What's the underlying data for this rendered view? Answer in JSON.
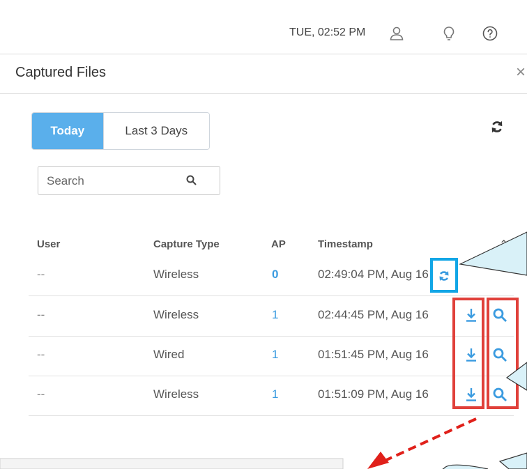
{
  "header": {
    "datetime": "TUE, 02:52 PM",
    "icons": [
      "user-icon",
      "lightbulb-icon",
      "help-icon"
    ]
  },
  "dialog": {
    "title": "Captured Files",
    "close_label": "×",
    "tabs": [
      {
        "label": "Today",
        "active": true
      },
      {
        "label": "Last 3 Days",
        "active": false
      }
    ],
    "search_placeholder": "Search",
    "columns": {
      "user": "User",
      "capture_type": "Capture Type",
      "ap": "AP",
      "timestamp": "Timestamp"
    },
    "rows": [
      {
        "user": "--",
        "capture_type": "Wireless",
        "ap": "0",
        "timestamp": "02:49:04 PM, Aug 16",
        "action": "in-progress"
      },
      {
        "user": "--",
        "capture_type": "Wireless",
        "ap": "1",
        "timestamp": "02:44:45 PM, Aug 16",
        "action": "download-view"
      },
      {
        "user": "--",
        "capture_type": "Wired",
        "ap": "1",
        "timestamp": "01:51:45 PM, Aug 16",
        "action": "download-view"
      },
      {
        "user": "--",
        "capture_type": "Wireless",
        "ap": "1",
        "timestamp": "01:51:09 PM, Aug 16",
        "action": "download-view"
      }
    ]
  },
  "colors": {
    "accent": "#5aafeb",
    "link": "#3a9be0",
    "highlight_blue": "#12a6e6",
    "highlight_red": "#e0403a",
    "callout_fill": "#d9f1f8"
  }
}
